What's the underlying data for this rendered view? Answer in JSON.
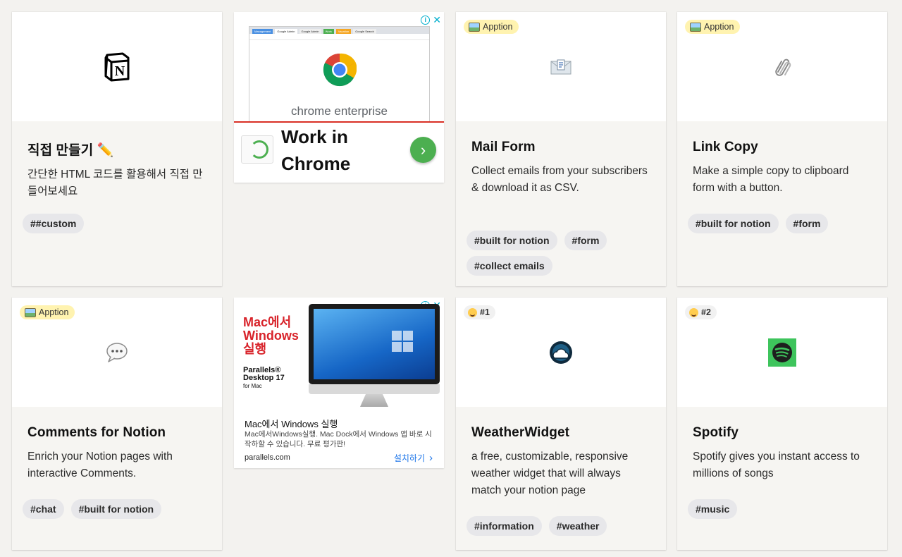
{
  "cards": [
    {
      "title": "직접 만들기 ✏️",
      "desc": "간단한 HTML 코드를 활용해서 직접 만들어보세요",
      "tags": [
        "##custom"
      ],
      "icon": "notion-logo-icon"
    },
    {
      "badge": "Apption",
      "title": "Mail Form",
      "desc": "Collect emails from your subscribers & download it as CSV.",
      "tags": [
        "#built for notion",
        "#form",
        "#collect emails"
      ],
      "icon": "envelope-icon"
    },
    {
      "badge": "Apption",
      "title": "Link Copy",
      "desc": "Make a simple copy to clipboard form with a button.",
      "tags": [
        "#built for notion",
        "#form"
      ],
      "icon": "paperclip-icon"
    },
    {
      "badge": "Apption",
      "title": "Comments for Notion",
      "desc": "Enrich your Notion pages with interactive Comments.",
      "tags": [
        "#chat",
        "#built for notion"
      ],
      "icon": "speech-bubble-icon"
    },
    {
      "rank": "#1",
      "title": "WeatherWidget",
      "desc": "a free, customizable, responsive weather widget that will always match your notion page",
      "tags": [
        "#information",
        "#weather"
      ],
      "icon": "weather-cloud-icon"
    },
    {
      "rank": "#2",
      "title": "Spotify",
      "desc": "Spotify gives you instant access to millions of songs",
      "tags": [
        "#music"
      ],
      "icon": "spotify-icon"
    }
  ],
  "ads": {
    "chrome": {
      "brand": "chrome enterprise",
      "headline_line1": "Work in",
      "headline_line2": "Chrome",
      "tabs": [
        "Management",
        "Google Admin",
        "Google Admin",
        "Work",
        "Vacation",
        "Google Search"
      ]
    },
    "parallels": {
      "headline_line1": "Mac에서",
      "headline_line2": "Windows",
      "headline_line3": "실행",
      "product_line1": "Parallels®",
      "product_line2": "Desktop 17",
      "product_line3": "for Mac",
      "title": "Mac에서 Windows 실행",
      "desc": "Mac에서Windows실행. Mac Dock에서 Windows 앱 바로 시작하할 수 있습니다. 무료 평가판!",
      "domain": "parallels.com",
      "cta": "설치하기"
    }
  },
  "colors": {
    "badge_bg": "#fff3b0",
    "tag_bg": "#e7e7ea",
    "card_bg": "#f6f5f2",
    "parallels_red": "#d8232a",
    "chrome_green": "#4caf50"
  }
}
